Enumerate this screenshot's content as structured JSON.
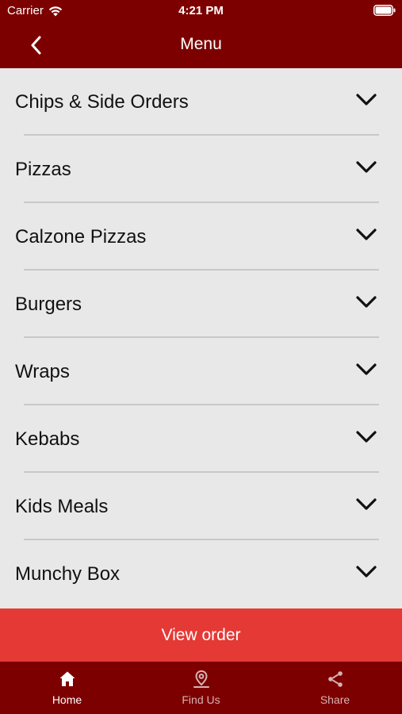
{
  "status_bar": {
    "carrier": "Carrier",
    "time": "4:21 PM",
    "icons": [
      "wifi-icon",
      "battery-icon"
    ]
  },
  "nav": {
    "back_icon": "chevron-left-icon",
    "title": "Menu"
  },
  "menu": {
    "items": [
      {
        "label": "Chips & Side Orders"
      },
      {
        "label": "Pizzas"
      },
      {
        "label": "Calzone Pizzas"
      },
      {
        "label": "Burgers"
      },
      {
        "label": "Wraps"
      },
      {
        "label": "Kebabs"
      },
      {
        "label": "Kids Meals"
      },
      {
        "label": "Munchy Box"
      }
    ],
    "expand_icon": "chevron-down-icon"
  },
  "view_order": {
    "label": "View order"
  },
  "tabs": [
    {
      "label": "Home",
      "icon": "home-icon",
      "active": true
    },
    {
      "label": "Find Us",
      "icon": "location-pin-icon",
      "active": false
    },
    {
      "label": "Share",
      "icon": "share-icon",
      "active": false
    }
  ],
  "colors": {
    "primary": "#7d0000",
    "accent": "#e53935",
    "background": "#e8e8e8",
    "divider": "#c8c8c8"
  }
}
